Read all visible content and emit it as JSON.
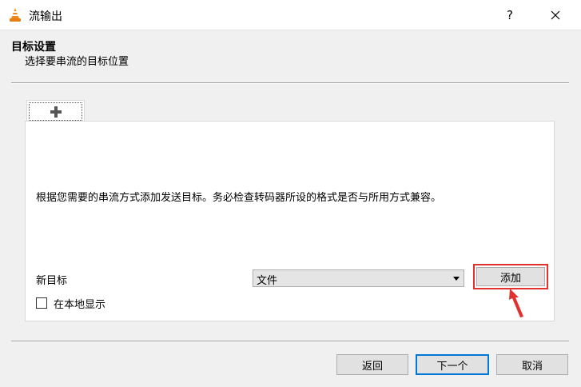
{
  "window": {
    "title": "流输出",
    "help_glyph": "?",
    "app_icon": "vlc-cone-icon",
    "close_icon": "close-icon"
  },
  "header": {
    "title": "目标设置",
    "subtitle": "选择要串流的目标位置"
  },
  "tabs": [
    {
      "label": "+",
      "icon": "plus-icon",
      "selected": true
    }
  ],
  "panel": {
    "description": "根据您需要的串流方式添加发送目标。务必检查转码器所设的格式是否与所用方式兼容。",
    "new_target_label": "新目标",
    "destination_select": {
      "value": "文件"
    },
    "add_button": "添加",
    "display_locally": {
      "label": "在本地显示",
      "checked": false
    }
  },
  "annotation": {
    "highlight_color": "#e0312f"
  },
  "footer": {
    "back": "返回",
    "next": "下一个",
    "cancel": "取消"
  },
  "colors": {
    "accent": "#0078d7",
    "dialog_bg": "#f0f0f0",
    "panel_bg": "#ffffff"
  }
}
